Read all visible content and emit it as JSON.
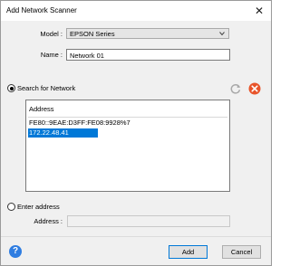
{
  "window": {
    "title": "Add Network Scanner",
    "close_glyph": "✕"
  },
  "form": {
    "model_label": "Model :",
    "model_value": "EPSON Series",
    "name_label": "Name :",
    "name_value": "Network 01"
  },
  "search": {
    "label": "Search for Network",
    "selected": true,
    "refresh_icon": "refresh-icon",
    "cancel_icon": "cancel-icon"
  },
  "list": {
    "header": "Address",
    "rows": [
      "FE80::9EAE:D3FF:FE08:9928%7",
      "172.22.48.41"
    ],
    "selected_index": 1
  },
  "manual": {
    "label": "Enter address",
    "selected": false,
    "address_label": "Address :",
    "address_value": ""
  },
  "buttons": {
    "help_glyph": "?",
    "add": "Add",
    "cancel": "Cancel"
  },
  "colors": {
    "selection": "#0078d7",
    "cancel_icon": "#e8542a",
    "help_icon": "#2f7de1"
  }
}
